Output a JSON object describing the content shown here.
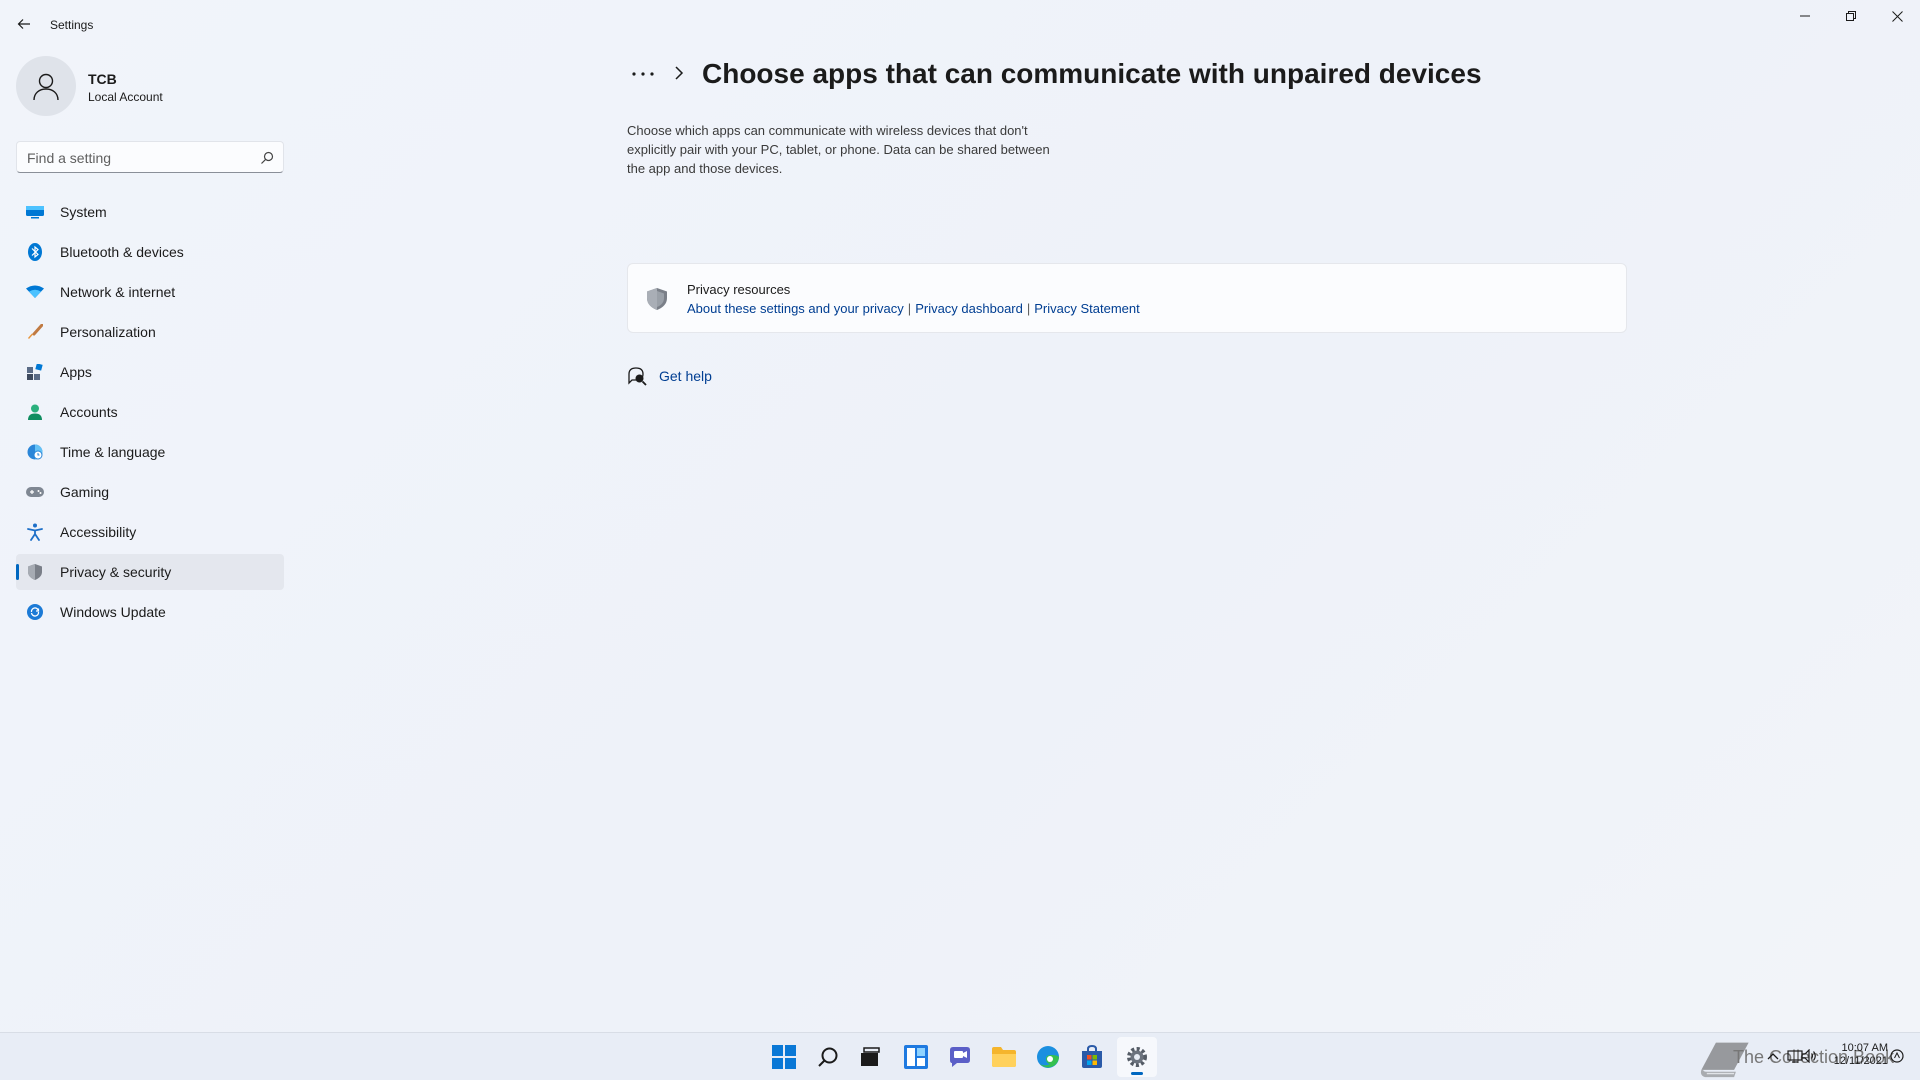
{
  "window": {
    "title": "Settings"
  },
  "profile": {
    "name": "TCB",
    "account_type": "Local Account"
  },
  "search": {
    "placeholder": "Find a setting",
    "value": ""
  },
  "sidebar": {
    "items": [
      {
        "label": "System",
        "icon": "monitor-icon",
        "active": false
      },
      {
        "label": "Bluetooth & devices",
        "icon": "bluetooth-icon",
        "active": false
      },
      {
        "label": "Network & internet",
        "icon": "wifi-icon",
        "active": false
      },
      {
        "label": "Personalization",
        "icon": "brush-icon",
        "active": false
      },
      {
        "label": "Apps",
        "icon": "apps-icon",
        "active": false
      },
      {
        "label": "Accounts",
        "icon": "person-icon",
        "active": false
      },
      {
        "label": "Time & language",
        "icon": "globe-clock-icon",
        "active": false
      },
      {
        "label": "Gaming",
        "icon": "gamepad-icon",
        "active": false
      },
      {
        "label": "Accessibility",
        "icon": "accessibility-icon",
        "active": false
      },
      {
        "label": "Privacy & security",
        "icon": "shield-icon",
        "active": true
      },
      {
        "label": "Windows Update",
        "icon": "update-icon",
        "active": false
      }
    ]
  },
  "main": {
    "title": "Choose apps that can communicate with unpaired devices",
    "description": "Choose which apps can communicate with wireless devices that don't explicitly pair with your PC, tablet, or phone. Data can be shared between the app and those devices.",
    "privacy_card": {
      "title": "Privacy resources",
      "links": [
        "About these settings and your privacy",
        "Privacy dashboard",
        "Privacy Statement"
      ],
      "separator": "|"
    },
    "help_label": "Get help"
  },
  "taskbar": {
    "apps": [
      "start-icon",
      "search-icon",
      "task-view-icon",
      "widgets-icon",
      "chat-icon",
      "file-explorer-icon",
      "edge-icon",
      "store-icon",
      "settings-icon"
    ],
    "watermark": "The Collection Book",
    "time": "10:07 AM",
    "date": "12/11/2021"
  },
  "colors": {
    "accent": "#0067c0",
    "link": "#003e92",
    "background": "#eef2f9"
  }
}
